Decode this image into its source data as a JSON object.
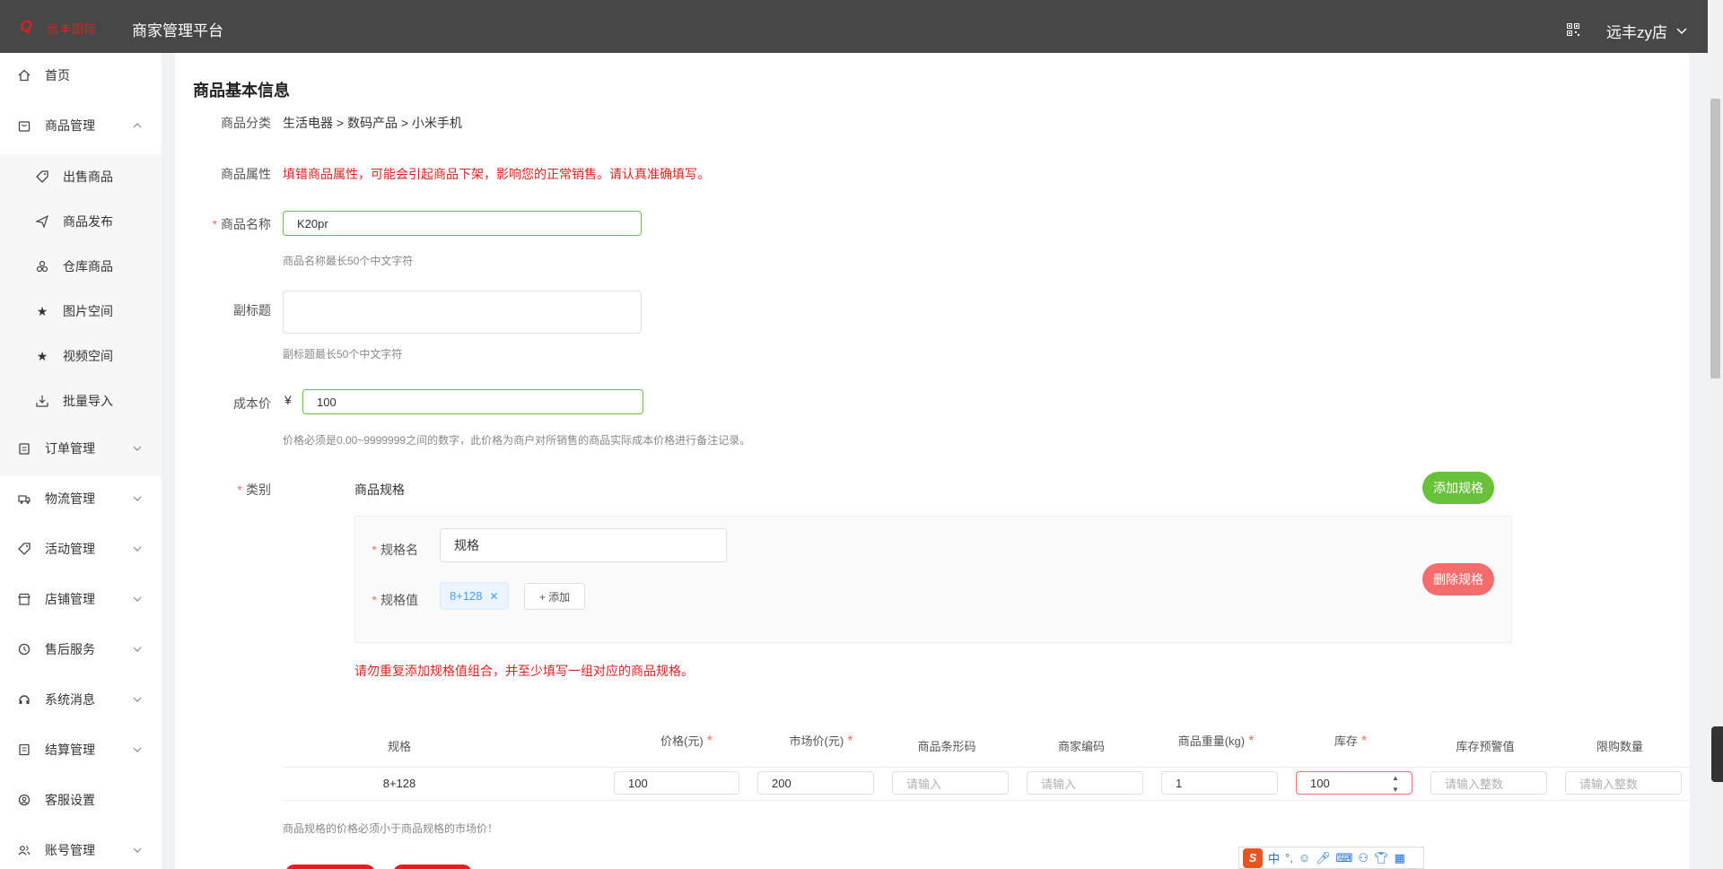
{
  "header": {
    "logo_text": "远丰国际",
    "platform_title": "商家管理平台",
    "shop_name": "远丰zy店"
  },
  "sidebar": {
    "items": [
      {
        "label": "首页"
      },
      {
        "label": "商品管理"
      },
      {
        "label": "订单管理"
      },
      {
        "label": "物流管理"
      },
      {
        "label": "活动管理"
      },
      {
        "label": "店铺管理"
      },
      {
        "label": "售后服务"
      },
      {
        "label": "系统消息"
      },
      {
        "label": "结算管理"
      },
      {
        "label": "客服设置"
      },
      {
        "label": "账号管理"
      }
    ],
    "sub_items": [
      {
        "label": "出售商品"
      },
      {
        "label": "商品发布"
      },
      {
        "label": "仓库商品"
      },
      {
        "label": "图片空间"
      },
      {
        "label": "视频空间"
      },
      {
        "label": "批量导入"
      }
    ]
  },
  "form": {
    "section_title": "商品基本信息",
    "category_label": "商品分类",
    "category_value": "生活电器 > 数码产品 > 小米手机",
    "attr_label": "商品属性",
    "attr_warning": "填错商品属性，可能会引起商品下架，影响您的正常销售。请认真准确填写。",
    "name_label": "商品名称",
    "name_value": "K20pr",
    "name_tip": "商品名称最长50个中文字符",
    "subtitle_label": "副标题",
    "subtitle_value": "",
    "subtitle_tip": "副标题最长50个中文字符",
    "cost_label": "成本价",
    "currency": "¥",
    "cost_value": "100",
    "cost_tip": "价格必须是0.00~9999999之间的数字，此价格为商户对所销售的商品实际成本价格进行备注记录。",
    "category_type_label": "类别",
    "spec_title": "商品规格",
    "add_spec_button": "添加规格",
    "spec_name_label": "规格名",
    "spec_name_value": "规格",
    "spec_value_label": "规格值",
    "spec_tag": "8+128",
    "spec_add_button": "+ 添加",
    "delete_spec_button": "删除规格",
    "spec_warning": "请勿重复添加规格值组合，并至少填写一组对应的商品规格。",
    "price_tip": "商品规格的价格必须小于商品规格的市场价！"
  },
  "table": {
    "headers": [
      {
        "label": "规格",
        "required": false
      },
      {
        "label": "价格(元)",
        "required": true
      },
      {
        "label": "市场价(元)",
        "required": true
      },
      {
        "label": "商品条形码",
        "required": false
      },
      {
        "label": "商家编码",
        "required": false
      },
      {
        "label": "商品重量(kg)",
        "required": true
      },
      {
        "label": "库存",
        "required": true
      },
      {
        "label": "库存预警值",
        "required": false
      },
      {
        "label": "限购数量",
        "required": false
      }
    ],
    "row": {
      "spec": "8+128",
      "price": "100",
      "market_price": "200",
      "barcode_placeholder": "请输入",
      "merchant_code_placeholder": "请输入",
      "weight": "1",
      "stock": "100",
      "stock_warning_placeholder": "请输入整数",
      "limit_placeholder": "请输入整数"
    }
  },
  "ime": {
    "lang": "中"
  },
  "colors": {
    "header_bg": "#474747",
    "success": "#67c23a",
    "danger": "#f56c6c",
    "warning_text": "#e02020",
    "tag_blue": "#409eff"
  }
}
